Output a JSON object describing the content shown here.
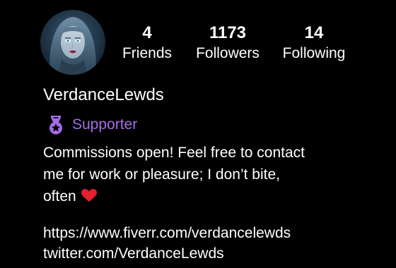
{
  "profile": {
    "avatar_alt": "profile avatar",
    "username": "VerdanceLewds",
    "badge": {
      "icon": "medal-icon",
      "label": "Supporter",
      "color": "#a46ee6"
    },
    "stats": [
      {
        "count": "4",
        "label": "Friends"
      },
      {
        "count": "1173",
        "label": "Followers"
      },
      {
        "count": "14",
        "label": "Following"
      }
    ],
    "bio": {
      "line1": "Commissions open! Feel free to contact",
      "line2": "me for work or pleasure; I don’t bite,",
      "line3": "often",
      "emoji": "heart-icon"
    },
    "links": [
      "https://www.fiverr.com/verdancelewds",
      "twitter.com/VerdanceLewds"
    ]
  },
  "colors": {
    "background": "#000000",
    "text": "#ffffff",
    "accent": "#a46ee6",
    "heart": "#e8202c"
  }
}
